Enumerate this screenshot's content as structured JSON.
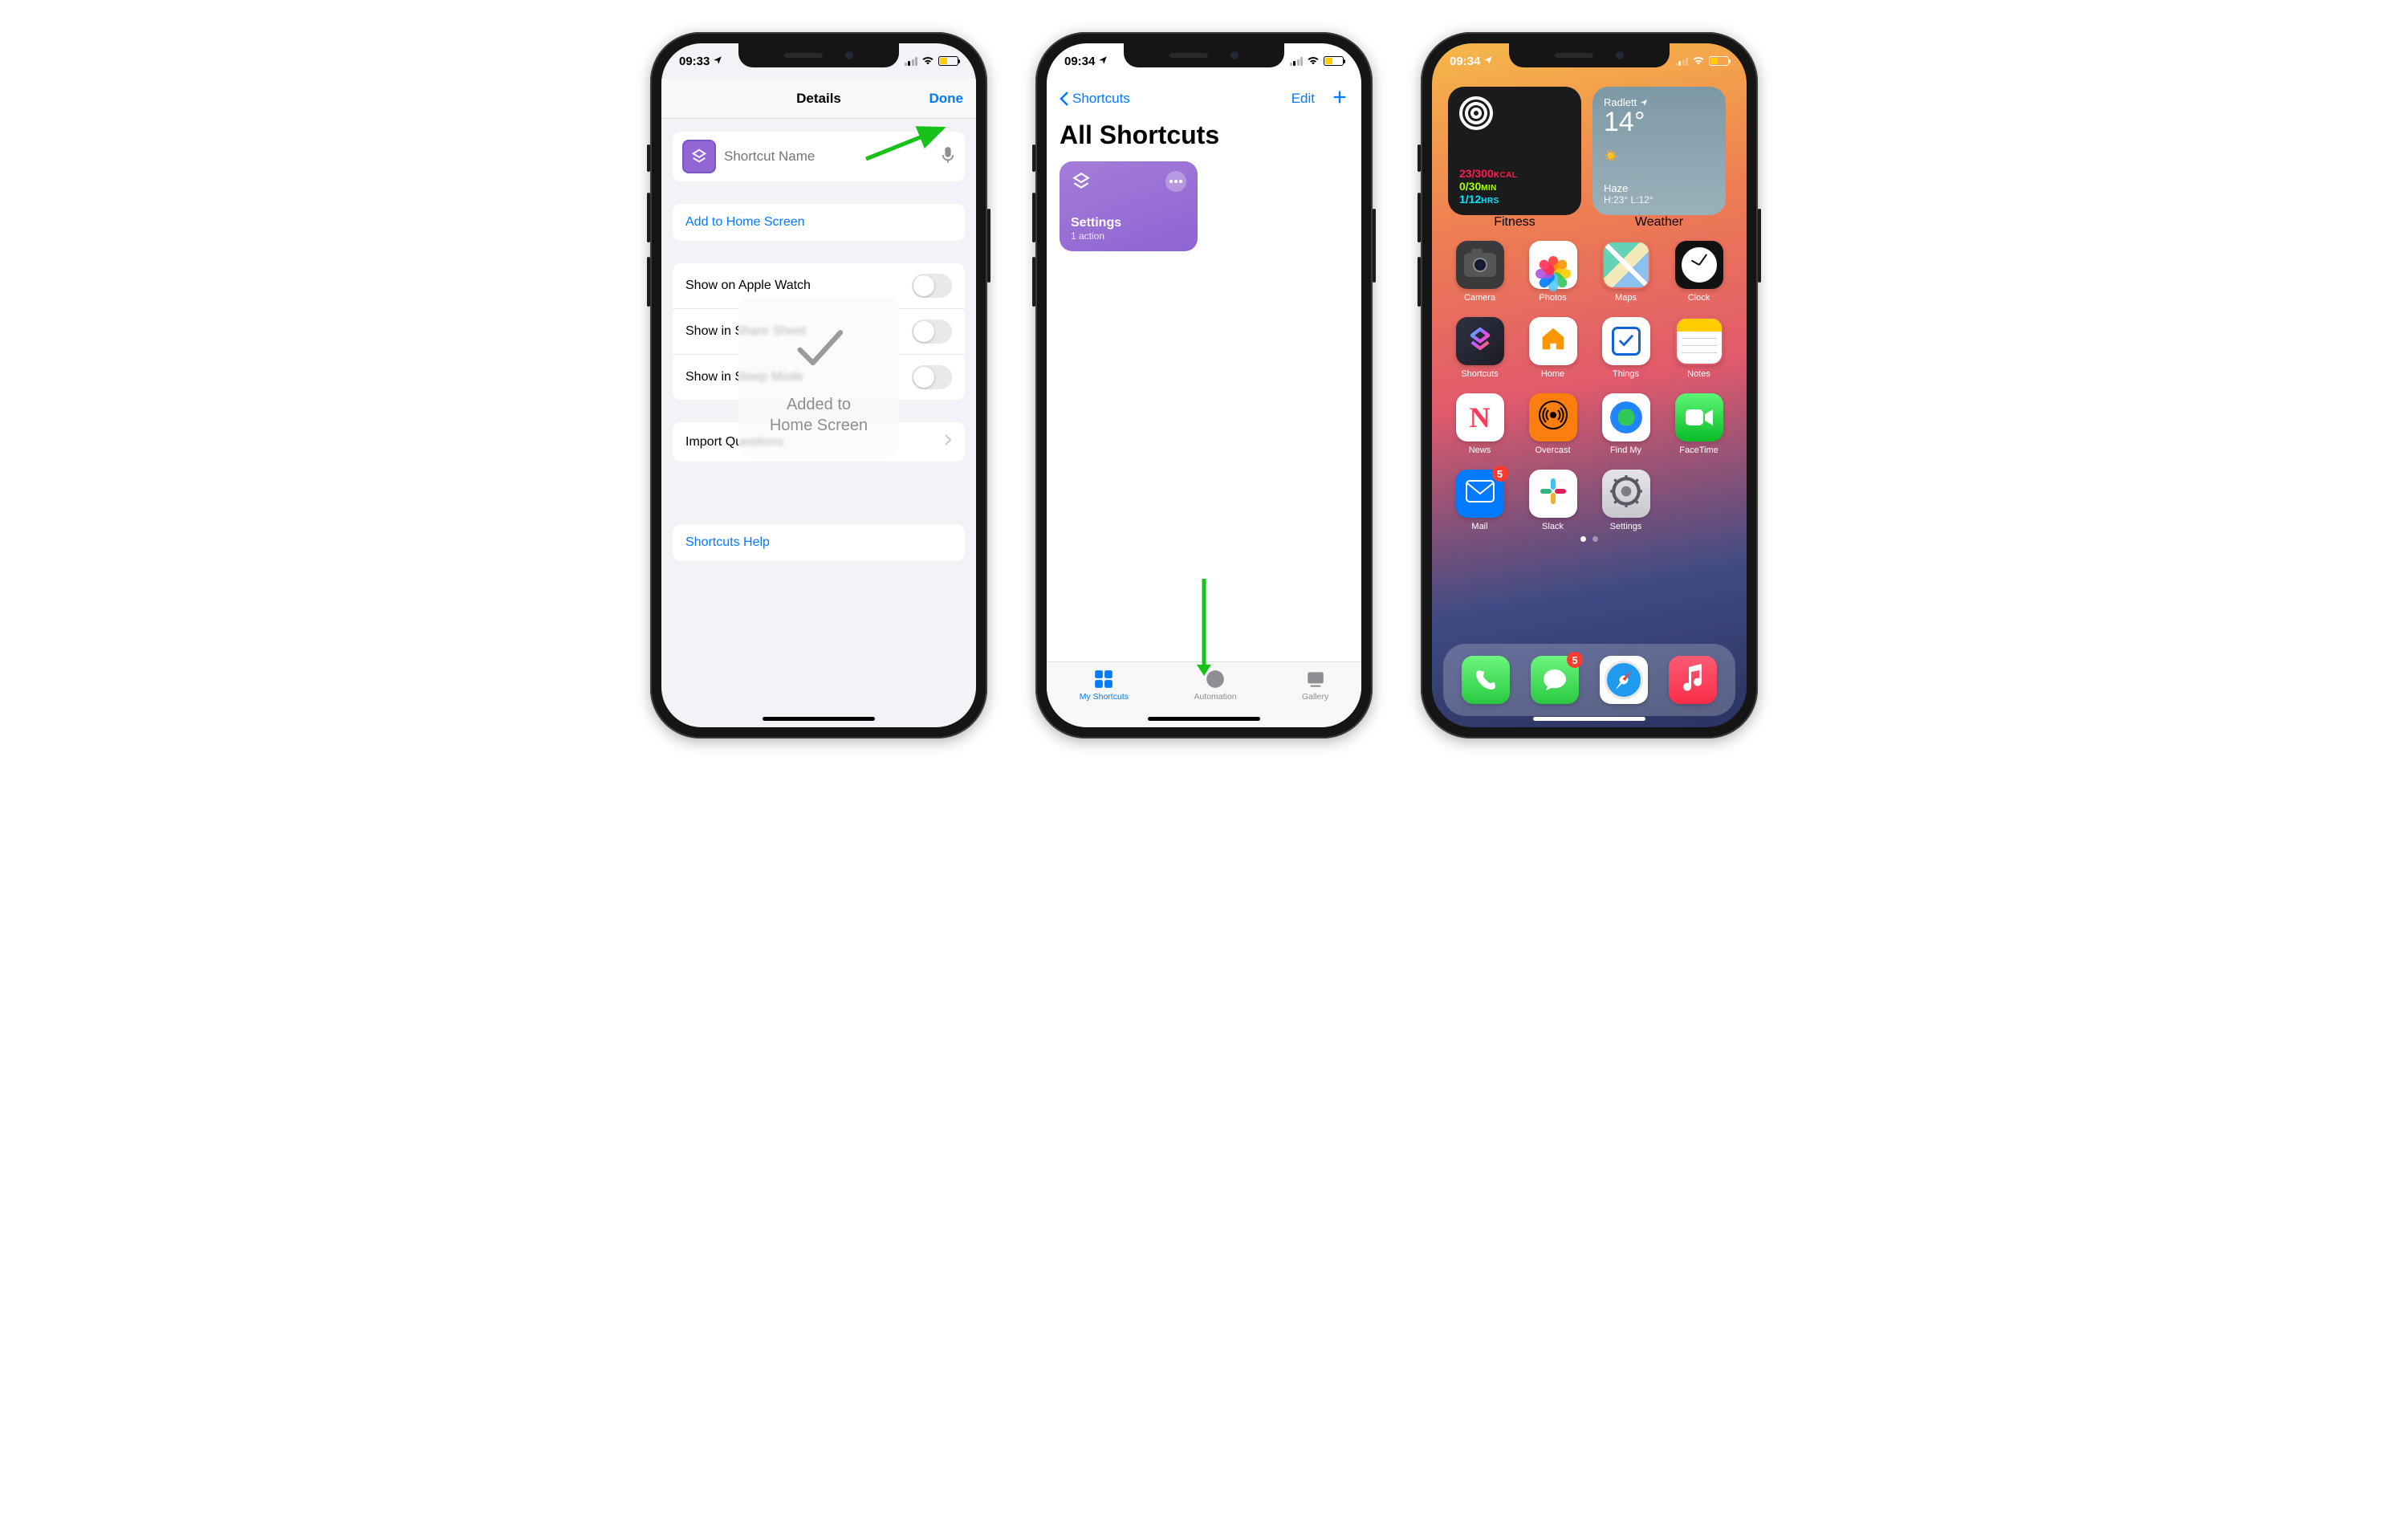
{
  "phone1": {
    "status": {
      "time": "09:33"
    },
    "nav": {
      "title": "Details",
      "done": "Done"
    },
    "name_placeholder": "Shortcut Name",
    "add_home": "Add to Home Screen",
    "toggles": {
      "watch": "Show on Apple Watch",
      "share": "Show in Share Sheet",
      "sleep": "Show in Sleep Mode"
    },
    "import_q": "Import Questions",
    "help": "Shortcuts Help",
    "toast": {
      "line1": "Added to",
      "line2": "Home Screen"
    }
  },
  "phone2": {
    "status": {
      "time": "09:34"
    },
    "back": "Shortcuts",
    "edit": "Edit",
    "title": "All Shortcuts",
    "card": {
      "name": "Settings",
      "sub": "1 action"
    },
    "tabs": {
      "my": "My Shortcuts",
      "auto": "Automation",
      "gallery": "Gallery"
    }
  },
  "phone3": {
    "status": {
      "time": "09:34"
    },
    "fitness": {
      "kcal": "23/300",
      "kcal_unit": "KCAL",
      "min": "0/30",
      "min_unit": "MIN",
      "hrs": "1/12",
      "hrs_unit": "HRS",
      "label": "Fitness"
    },
    "weather": {
      "location": "Radlett",
      "temp": "14°",
      "cond": "Haze",
      "hilo_h": "H:23°",
      "hilo_l": "L:12°",
      "label": "Weather"
    },
    "apps": {
      "camera": "Camera",
      "photos": "Photos",
      "maps": "Maps",
      "clock": "Clock",
      "shortcuts": "Shortcuts",
      "home": "Home",
      "things": "Things",
      "notes": "Notes",
      "news": "News",
      "overcast": "Overcast",
      "findmy": "Find My",
      "facetime": "FaceTime",
      "mail": "Mail",
      "slack": "Slack",
      "settings": "Settings"
    },
    "badges": {
      "mail": "5",
      "messages": "5"
    }
  }
}
